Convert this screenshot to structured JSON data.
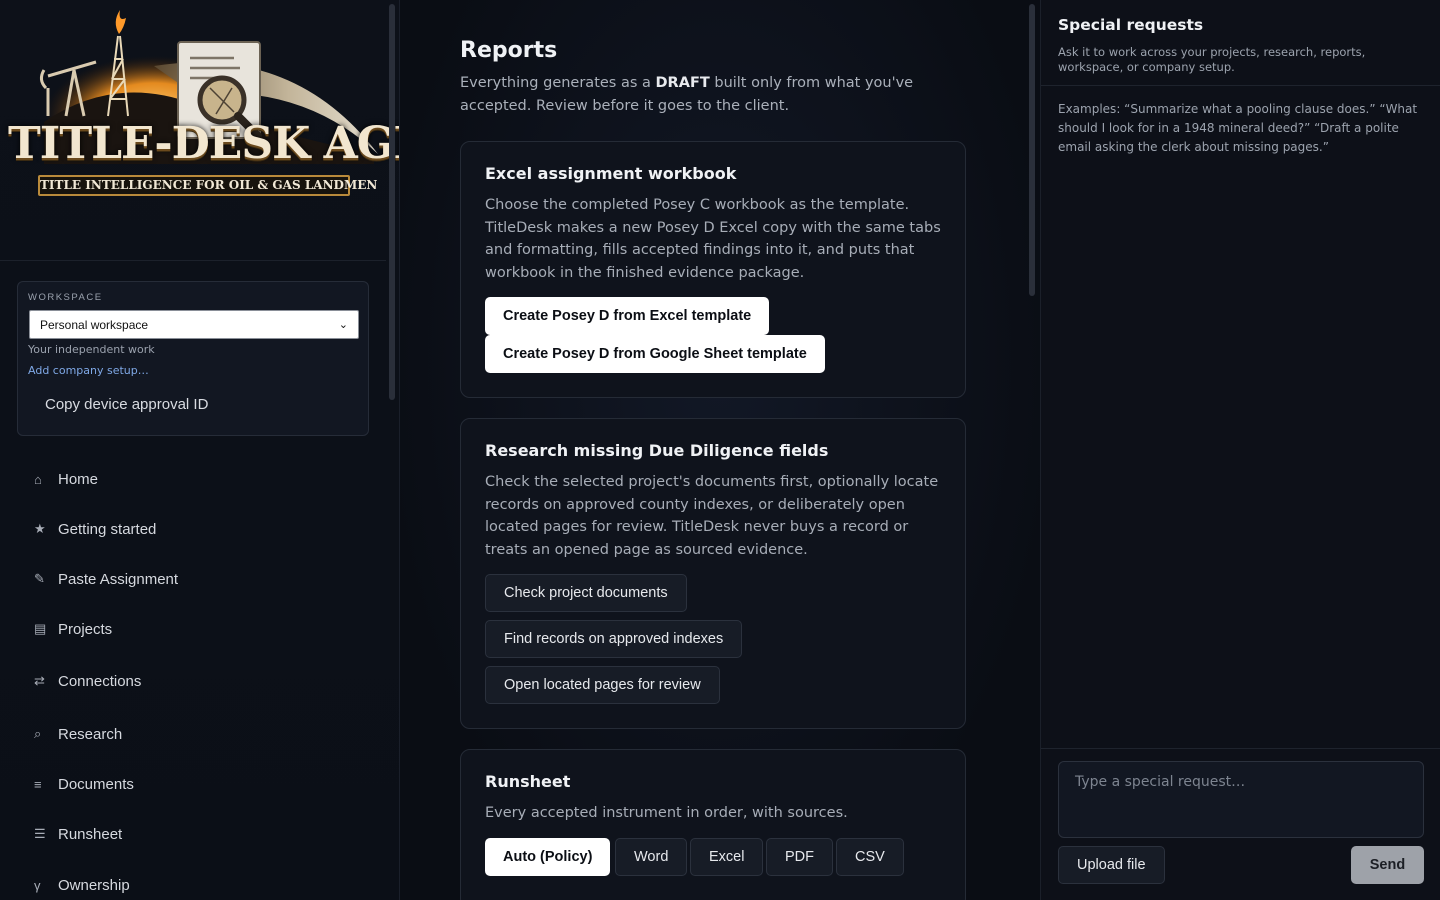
{
  "logo": {
    "title": "TITLE-DESK AGENT",
    "tagline": "TITLE INTELLIGENCE FOR OIL & GAS LANDMEN"
  },
  "workspace": {
    "label": "WORKSPACE",
    "selected": "Personal workspace",
    "subtitle": "Your independent work",
    "add_company_link": "Add company setup…",
    "copy_device": "Copy device approval ID"
  },
  "nav": {
    "items": [
      {
        "icon": "home-icon",
        "glyph": "⌂",
        "label": "Home"
      },
      {
        "icon": "star-icon",
        "glyph": "★",
        "label": "Getting started"
      },
      {
        "icon": "pencil-icon",
        "glyph": "✎",
        "label": "Paste Assignment"
      },
      {
        "icon": "folder-icon",
        "glyph": "▤",
        "label": "Projects"
      },
      {
        "icon": "connections-icon",
        "glyph": "⇄",
        "label": "Connections"
      },
      {
        "icon": "search-icon",
        "glyph": "⌕",
        "label": "Research"
      },
      {
        "icon": "documents-icon",
        "glyph": "≡",
        "label": "Documents"
      },
      {
        "icon": "list-icon",
        "glyph": "☰",
        "label": "Runsheet"
      },
      {
        "icon": "ownership-icon",
        "glyph": "γ",
        "label": "Ownership"
      }
    ]
  },
  "reports": {
    "title": "Reports",
    "subtitle_pre": "Everything generates as a ",
    "subtitle_bold": "DRAFT",
    "subtitle_post": " built only from what you've accepted. Review before it goes to the client."
  },
  "excel_card": {
    "title": "Excel assignment workbook",
    "description": "Choose the completed Posey C workbook as the template. TitleDesk makes a new Posey D Excel copy with the same tabs and formatting, fills accepted findings into it, and puts that workbook in the finished evidence package.",
    "btn_excel": "Create Posey D from Excel template",
    "btn_gsheet": "Create Posey D from Google Sheet template"
  },
  "research_card": {
    "title": "Research missing Due Diligence fields",
    "description": "Check the selected project's documents first, optionally locate records on approved county indexes, or deliberately open located pages for review. TitleDesk never buys a record or treats an opened page as sourced evidence.",
    "btn_check": "Check project documents",
    "btn_find": "Find records on approved indexes",
    "btn_open": "Open located pages for review"
  },
  "runsheet_card": {
    "title": "Runsheet",
    "description": "Every accepted instrument in order, with sources.",
    "formats": [
      "Auto (Policy)",
      "Word",
      "Excel",
      "PDF",
      "CSV"
    ]
  },
  "special_requests": {
    "title": "Special requests",
    "subtitle": "Ask it to work across your projects, research, reports, workspace, or company setup.",
    "examples": "Examples: “Summarize what a pooling clause does.” “What should I look for in a 1948 mineral deed?” “Draft a polite email asking the clerk about missing pages.”",
    "placeholder": "Type a special request…",
    "upload_label": "Upload file",
    "send_label": "Send"
  }
}
